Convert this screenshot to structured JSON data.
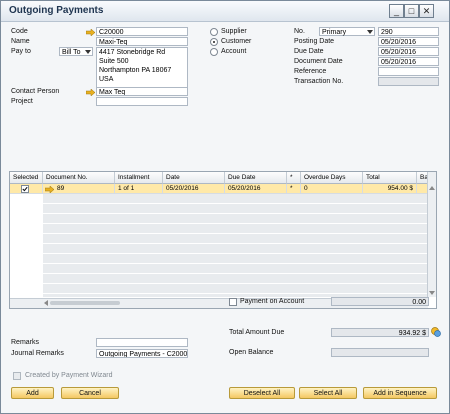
{
  "window": {
    "title": "Outgoing Payments"
  },
  "form": {
    "code_label": "Code",
    "code_value": "C20000",
    "name_label": "Name",
    "name_value": "Maxi-Teq",
    "payto_label": "Pay to",
    "payto_select": "Bill To",
    "address_lines": [
      "4417 Stonebridge Rd",
      "Suite 500",
      "Northampton  PA  18067",
      "USA"
    ],
    "contact_label": "Contact Person",
    "contact_value": "Max Teq",
    "project_label": "Project",
    "project_value": ""
  },
  "type_options": {
    "supplier": "Supplier",
    "customer": "Customer",
    "account": "Account",
    "selected": "customer"
  },
  "header_right": {
    "no_label": "No.",
    "series_value": "Primary",
    "no_value": "290",
    "posting_label": "Posting Date",
    "posting_value": "05/20/2016",
    "due_label": "Due Date",
    "due_value": "05/20/2016",
    "docdate_label": "Document Date",
    "docdate_value": "05/20/2016",
    "reference_label": "Reference",
    "reference_value": "",
    "transaction_label": "Transaction No.",
    "transaction_value": ""
  },
  "table": {
    "columns": [
      "Selected",
      "Document No.",
      "Installment",
      "Date",
      "Due Date",
      "*",
      "Overdue Days",
      "Total",
      "Bal..."
    ],
    "rows": [
      {
        "selected": true,
        "document_no": "89",
        "installment": "1 of 1",
        "date": "05/20/2016",
        "due_date": "05/20/2016",
        "star": "*",
        "overdue_days": "0",
        "total": "954.00 $"
      }
    ]
  },
  "payment_on_account": {
    "label": "Payment on Account",
    "value": "0.00"
  },
  "totals": {
    "total_due_label": "Total Amount Due",
    "total_due_value": "934.92 $",
    "open_balance_label": "Open Balance",
    "open_balance_value": ""
  },
  "remarks": {
    "label": "Remarks",
    "value": "",
    "journal_label": "Journal Remarks",
    "journal_value": "Outgoing Payments - C20000"
  },
  "wizard": {
    "label": "Created by Payment Wizard"
  },
  "buttons": {
    "add": "Add",
    "cancel": "Cancel",
    "deselect_all": "Deselect All",
    "select_all": "Select All",
    "add_in_sequence": "Add in Sequence"
  },
  "colors": {
    "accent": "#f4c862",
    "selected_row": "#ffe9a8",
    "link_arrow": "#e8b020"
  }
}
